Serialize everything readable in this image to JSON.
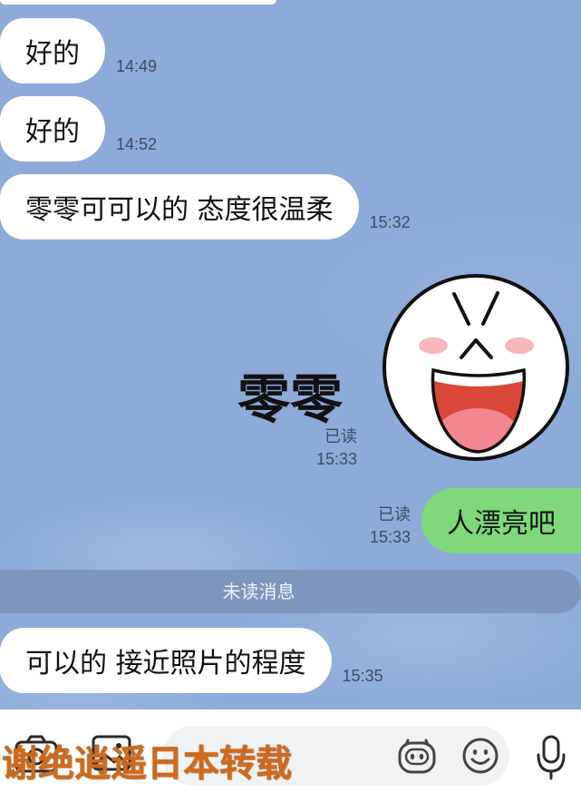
{
  "incoming": [
    {
      "text": "好的",
      "time": "14:49"
    },
    {
      "text": "好的",
      "time": "14:52"
    },
    {
      "text": "零零可可以的 态度很温柔",
      "time": "15:32"
    }
  ],
  "sticker_message": {
    "sticker_icon": "laughing-face-sticker-icon",
    "caption": "零零",
    "read_status": "已读",
    "time": "15:33"
  },
  "outgoing": [
    {
      "text": "人漂亮吧",
      "read_status": "已读",
      "time": "15:33"
    }
  ],
  "unread_divider": {
    "label": "未读消息"
  },
  "new_incoming": [
    {
      "text": "可以的 接近照片的程度",
      "time": "15:35"
    }
  ],
  "input_bar": {
    "camera_icon": "camera-icon",
    "image_icon": "image-icon",
    "sticker_icon": "sticker-icon",
    "emoji_icon": "emoji-icon",
    "mic_icon": "mic-icon"
  },
  "watermark": {
    "text": "谢绝逍遥日本转载"
  },
  "colors": {
    "background": "#8cabd9",
    "incoming_bubble": "#ffffff",
    "outgoing_bubble": "#7fd97b",
    "divider_bar": "#7e96bd",
    "meta_text": "#3e4c64",
    "input_field": "#f1f2f4",
    "watermark": "#cf6a1c"
  }
}
